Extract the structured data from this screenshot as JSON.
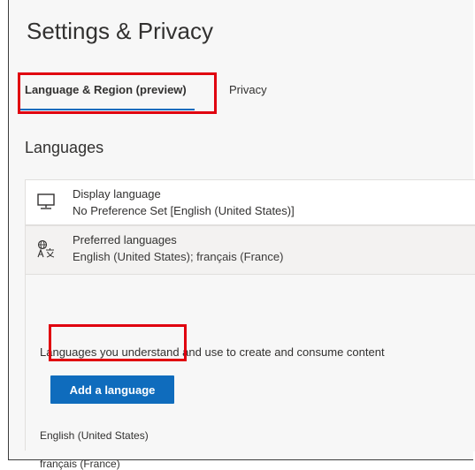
{
  "page": {
    "title": "Settings & Privacy"
  },
  "tabs": [
    {
      "label": "Language & Region (preview)",
      "selected": true
    },
    {
      "label": "Privacy",
      "selected": false
    }
  ],
  "languages": {
    "heading": "Languages",
    "display": {
      "icon": "monitor-icon",
      "title": "Display language",
      "value": "No Preference Set [English (United States)]"
    },
    "preferred": {
      "icon": "language-icon",
      "title": "Preferred languages",
      "value": "English (United States); français (France)",
      "description": "Languages you understand and use to create and consume content",
      "add_button_label": "Add a language",
      "items": [
        "English (United States)",
        "français (France)"
      ]
    }
  },
  "colors": {
    "accent": "#0f6cbd",
    "highlight": "#e0000f"
  }
}
